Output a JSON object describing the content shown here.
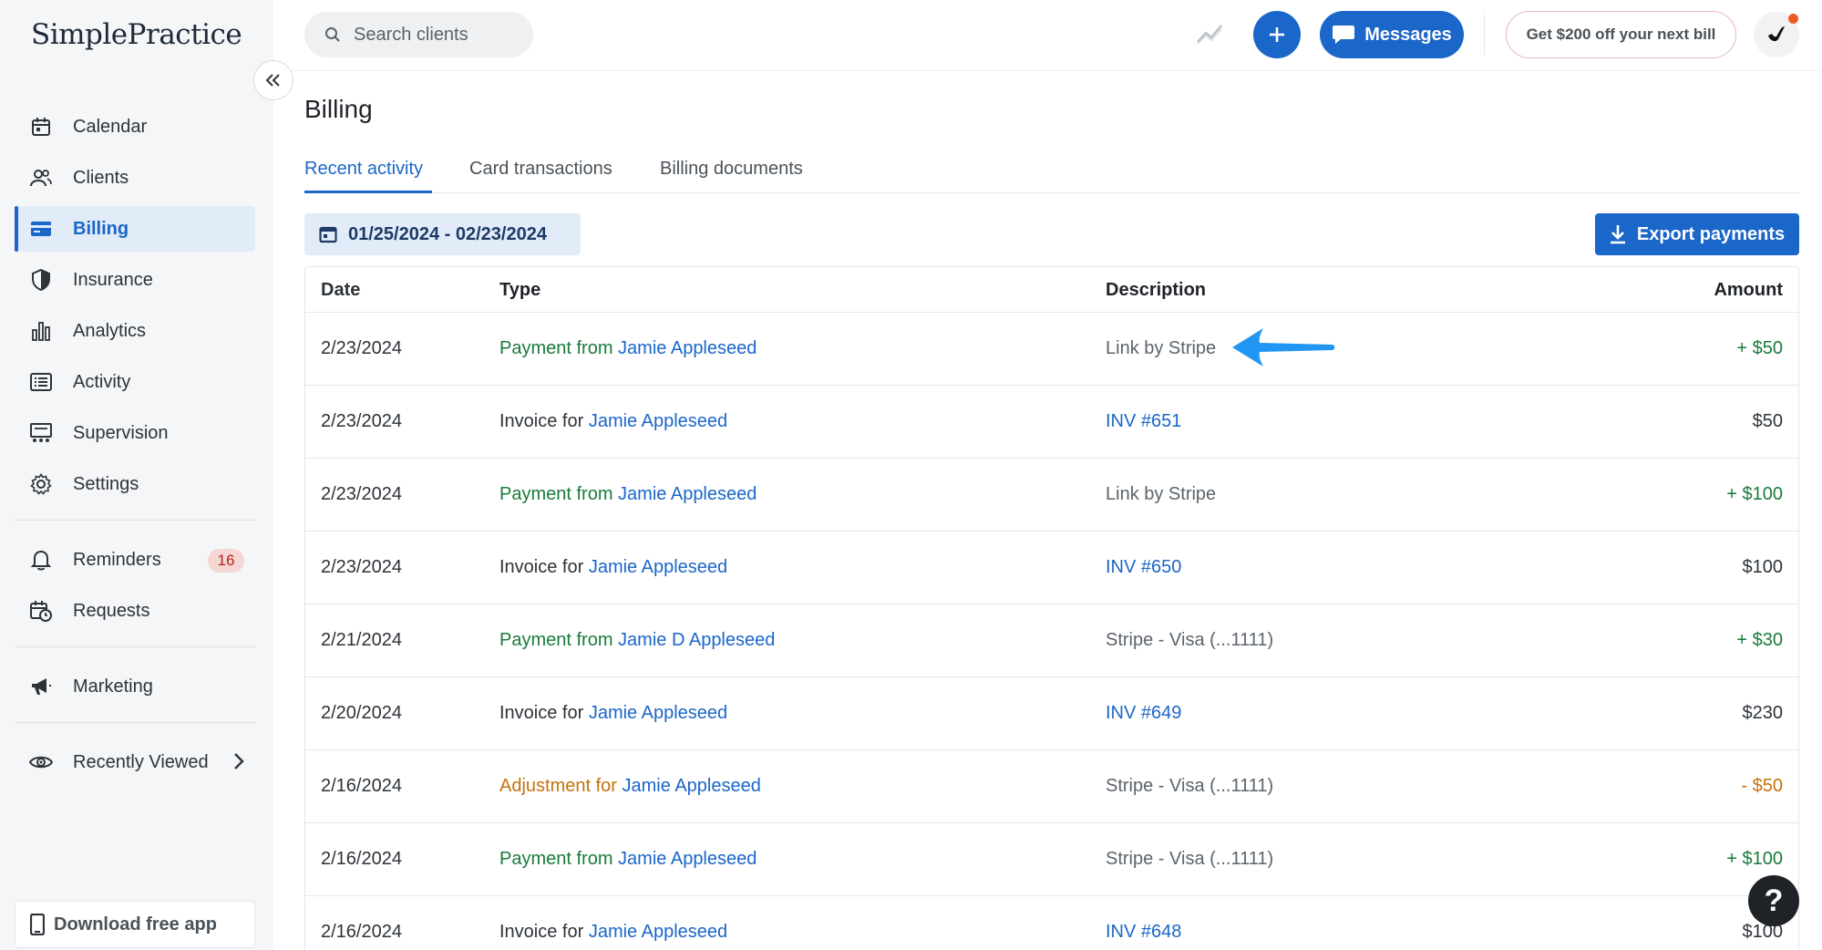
{
  "app": {
    "logo": "SimplePractice"
  },
  "sidebar": {
    "items": [
      {
        "label": "Calendar",
        "icon": "calendar-icon"
      },
      {
        "label": "Clients",
        "icon": "clients-icon"
      },
      {
        "label": "Billing",
        "icon": "billing-card-icon",
        "active": true
      },
      {
        "label": "Insurance",
        "icon": "shield-icon"
      },
      {
        "label": "Analytics",
        "icon": "bar-chart-icon"
      },
      {
        "label": "Activity",
        "icon": "list-icon"
      },
      {
        "label": "Supervision",
        "icon": "supervision-icon"
      },
      {
        "label": "Settings",
        "icon": "gear-icon"
      }
    ],
    "reminders": {
      "label": "Reminders",
      "count": "16",
      "icon": "bell-icon"
    },
    "requests": {
      "label": "Requests",
      "icon": "calendar-clock-icon"
    },
    "marketing": {
      "label": "Marketing",
      "icon": "megaphone-icon"
    },
    "recently_viewed": {
      "label": "Recently Viewed",
      "icon": "eye-icon"
    },
    "download": {
      "label": "Download free app",
      "icon": "phone-icon"
    }
  },
  "topbar": {
    "search_placeholder": "Search clients",
    "messages_label": "Messages",
    "promo_label": "Get $200 off your next bill"
  },
  "page": {
    "title": "Billing",
    "tabs": [
      {
        "label": "Recent activity",
        "active": true
      },
      {
        "label": "Card transactions"
      },
      {
        "label": "Billing documents"
      }
    ],
    "date_range": "01/25/2024 - 02/23/2024",
    "export_label": "Export payments"
  },
  "table": {
    "headers": {
      "date": "Date",
      "type": "Type",
      "description": "Description",
      "amount": "Amount"
    },
    "rows": [
      {
        "date": "2/23/2024",
        "type_prefix": "Payment from ",
        "client": "Jamie Appleseed",
        "description": "Link by Stripe",
        "amount": "+ $50"
      },
      {
        "date": "2/23/2024",
        "type_prefix": "Invoice for ",
        "client": "Jamie Appleseed",
        "description": "INV #651",
        "amount": "$50"
      },
      {
        "date": "2/23/2024",
        "type_prefix": "Payment from ",
        "client": "Jamie Appleseed",
        "description": "Link by Stripe",
        "amount": "+ $100"
      },
      {
        "date": "2/23/2024",
        "type_prefix": "Invoice for ",
        "client": "Jamie Appleseed",
        "description": "INV #650",
        "amount": "$100"
      },
      {
        "date": "2/21/2024",
        "type_prefix": "Payment from ",
        "client": "Jamie D Appleseed",
        "description": "Stripe - Visa (...1111)",
        "amount": "+ $30"
      },
      {
        "date": "2/20/2024",
        "type_prefix": "Invoice for ",
        "client": "Jamie Appleseed",
        "description": "INV #649",
        "amount": "$230"
      },
      {
        "date": "2/16/2024",
        "type_prefix": "Adjustment for ",
        "client": "Jamie Appleseed",
        "description": "Stripe - Visa (...1111)",
        "amount": "- $50"
      },
      {
        "date": "2/16/2024",
        "type_prefix": "Payment from ",
        "client": "Jamie Appleseed",
        "description": "Stripe - Visa (...1111)",
        "amount": "+ $100"
      },
      {
        "date": "2/16/2024",
        "type_prefix": "Invoice for ",
        "client": "Jamie Appleseed",
        "description": "INV #648",
        "amount": "$100"
      }
    ]
  },
  "help": {
    "label": "?"
  },
  "colors": {
    "accent": "#1b66c9",
    "payment": "#1a7a3b",
    "adjustment": "#c4720a",
    "badge_bg": "#f6d6d2",
    "annotation_arrow": "#2196f3"
  }
}
